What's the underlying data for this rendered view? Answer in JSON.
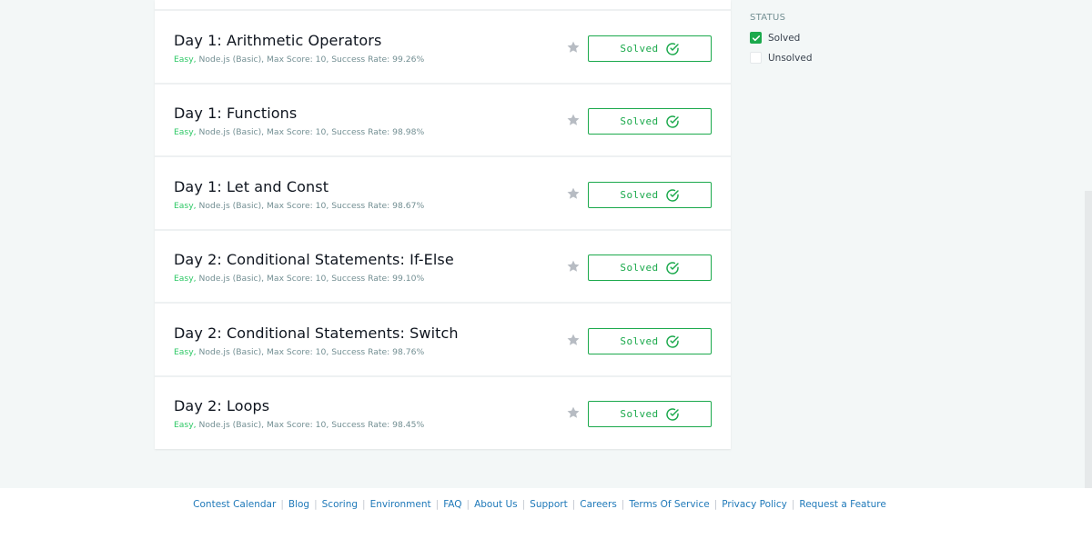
{
  "challenges": [
    {
      "title": "Day 1: Arithmetic Operators",
      "difficulty": "Easy,",
      "meta": " Node.js (Basic), Max Score: 10, Success Rate: 99.26%",
      "status_label": "Solved"
    },
    {
      "title": "Day 1: Functions",
      "difficulty": "Easy,",
      "meta": " Node.js (Basic), Max Score: 10, Success Rate: 98.98%",
      "status_label": "Solved"
    },
    {
      "title": "Day 1: Let and Const",
      "difficulty": "Easy,",
      "meta": " Node.js (Basic), Max Score: 10, Success Rate: 98.67%",
      "status_label": "Solved"
    },
    {
      "title": "Day 2: Conditional Statements: If-Else",
      "difficulty": "Easy,",
      "meta": " Node.js (Basic), Max Score: 10, Success Rate: 99.10%",
      "status_label": "Solved"
    },
    {
      "title": "Day 2: Conditional Statements: Switch",
      "difficulty": "Easy,",
      "meta": " Node.js (Basic), Max Score: 10, Success Rate: 98.76%",
      "status_label": "Solved"
    },
    {
      "title": "Day 2: Loops",
      "difficulty": "Easy,",
      "meta": " Node.js (Basic), Max Score: 10, Success Rate: 98.45%",
      "status_label": "Solved"
    }
  ],
  "filter": {
    "title": "STATUS",
    "options": [
      {
        "label": "Solved",
        "checked": true
      },
      {
        "label": "Unsolved",
        "checked": false
      }
    ]
  },
  "footer": {
    "links": [
      "Contest Calendar",
      "Blog",
      "Scoring",
      "Environment",
      "FAQ",
      "About Us",
      "Support",
      "Careers",
      "Terms Of Service",
      "Privacy Policy",
      "Request a Feature"
    ]
  },
  "colors": {
    "accent": "#1ba94c",
    "difficulty_easy": "#2ec866",
    "link": "#1f79b9"
  },
  "icons": {
    "bookmark": "star-icon",
    "solved": "check-circle-icon",
    "checkbox": "checkmark-icon"
  }
}
